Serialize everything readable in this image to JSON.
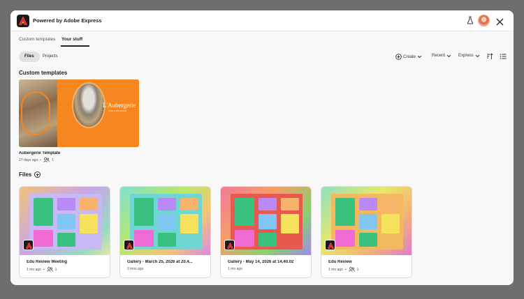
{
  "header": {
    "brand": "Powered by Adobe Express"
  },
  "tabs": [
    {
      "label": "Custom templates"
    },
    {
      "label": "Your stuff"
    }
  ],
  "toolbar": {
    "files_label": "Files",
    "projects_label": "Projects",
    "create_label": "Create",
    "sort_label": "Recent",
    "filter_label": "Express"
  },
  "custom_templates": {
    "title": "Custom templates",
    "items": [
      {
        "name": "Aubergerie Template",
        "age": "27 days ago",
        "shares": "1",
        "art_title": "L'Aubergerie",
        "art_subtitle": "Hotel in Unmatched"
      }
    ]
  },
  "files": {
    "title": "Files",
    "items": [
      {
        "name": "Edu Review Meeting",
        "age": "1 mo ago",
        "shares": "1"
      },
      {
        "name": "Gallery - March 25, 2026 at 20.4...",
        "age": "3 mos ago",
        "shares": ""
      },
      {
        "name": "Gallery - May 14, 2026 at 14.40.02",
        "age": "1 mo ago",
        "shares": ""
      },
      {
        "name": "Edu Review",
        "age": "1 mo ago",
        "shares": "1"
      }
    ]
  },
  "colors": {
    "accent": "#f6861f",
    "modal_bg": "#f8f8f8",
    "backdrop": "#6e6e6e"
  }
}
